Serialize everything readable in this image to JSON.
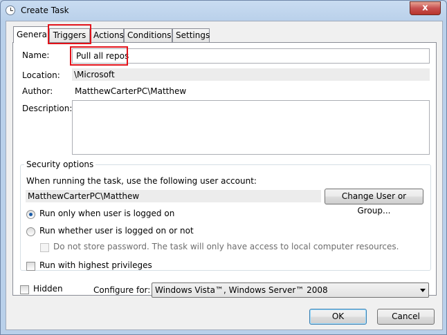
{
  "window": {
    "title": "Create Task",
    "close_label": "x"
  },
  "tabs": [
    {
      "label": "General"
    },
    {
      "label": "Triggers"
    },
    {
      "label": "Actions"
    },
    {
      "label": "Conditions"
    },
    {
      "label": "Settings"
    }
  ],
  "general": {
    "name_label": "Name:",
    "name_value": "Pull all repos",
    "location_label": "Location:",
    "location_value": "\\Microsoft",
    "author_label": "Author:",
    "author_value": "MatthewCarterPC\\Matthew",
    "description_label": "Description:",
    "description_value": ""
  },
  "security": {
    "group_label": "Security options",
    "account_prompt": "When running the task, use the following user account:",
    "account_value": "MatthewCarterPC\\Matthew",
    "change_button": "Change User or Group...",
    "radio_logged_on": "Run only when user is logged on",
    "radio_whether": "Run whether user is logged on or not",
    "no_store_password": "Do not store password.  The task will only have access to local computer resources.",
    "highest_privileges": "Run with highest privileges"
  },
  "footer": {
    "hidden_label": "Hidden",
    "configure_label": "Configure for:",
    "configure_value": "Windows Vista™, Windows Server™ 2008",
    "ok_label": "OK",
    "cancel_label": "Cancel"
  }
}
